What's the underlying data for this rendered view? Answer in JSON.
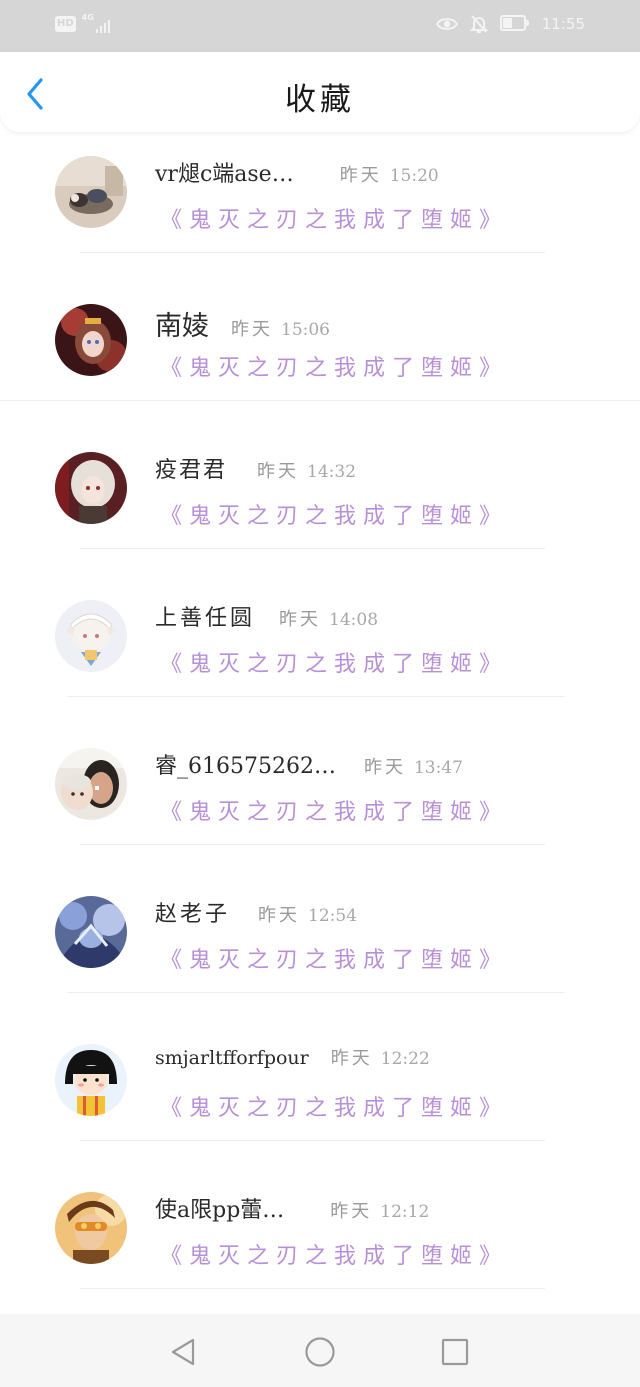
{
  "status_bar": {
    "hd": "HD",
    "network": "4G",
    "time": "11:55",
    "battery_level": 0.45,
    "icons": [
      "eye-icon",
      "bell-off-icon",
      "battery-icon"
    ]
  },
  "header": {
    "title": "收藏",
    "back_icon": "chevron-left-icon",
    "accent_color": "#2196f3"
  },
  "title_color": "#b890d8",
  "items": [
    {
      "name": "vr煺c端ase…",
      "date": "昨天",
      "time": "15:20",
      "book": "《鬼灭之刃之我成了堕姬》",
      "avatar": "avatar-photo-dog"
    },
    {
      "name": "南婈",
      "date": "昨天",
      "time": "15:06",
      "book": "《鬼灭之刃之我成了堕姬》",
      "avatar": "avatar-anime-girl-red"
    },
    {
      "name": "疫君君",
      "date": "昨天",
      "time": "14:32",
      "book": "《鬼灭之刃之我成了堕姬》",
      "avatar": "avatar-anime-white-hair"
    },
    {
      "name": "上善任圆",
      "date": "昨天",
      "time": "14:08",
      "book": "《鬼灭之刃之我成了堕姬》",
      "avatar": "avatar-anime-chibi"
    },
    {
      "name": "睿_616575262…",
      "date": "昨天",
      "time": "13:47",
      "book": "《鬼灭之刃之我成了堕姬》",
      "avatar": "avatar-photo-baby"
    },
    {
      "name": "赵老子",
      "date": "昨天",
      "time": "12:54",
      "book": "《鬼灭之刃之我成了堕姬》",
      "avatar": "avatar-anime-blue"
    },
    {
      "name": "smjarltfforfpour",
      "date": "昨天",
      "time": "12:22",
      "book": "《鬼灭之刃之我成了堕姬》",
      "avatar": "avatar-cartoon-maruko"
    },
    {
      "name": "使a限pp蕾…",
      "date": "昨天",
      "time": "12:12",
      "book": "《鬼灭之刃之我成了堕姬》",
      "avatar": "avatar-anime-goggles"
    }
  ],
  "nav_bar": {
    "icons": [
      "back-triangle-icon",
      "home-circle-icon",
      "recents-square-icon"
    ]
  }
}
